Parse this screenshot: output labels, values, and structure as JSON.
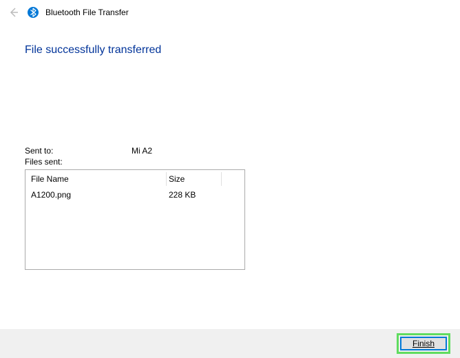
{
  "header": {
    "title": "Bluetooth File Transfer"
  },
  "status": {
    "heading": "File successfully transferred"
  },
  "transfer": {
    "sent_to_label": "Sent to:",
    "sent_to_value": "Mi A2",
    "files_sent_label": "Files sent:"
  },
  "table": {
    "columns": {
      "name": "File Name",
      "size": "Size"
    },
    "rows": [
      {
        "name": "A1200.png",
        "size": "228 KB"
      }
    ]
  },
  "footer": {
    "finish_label": "Finish"
  }
}
